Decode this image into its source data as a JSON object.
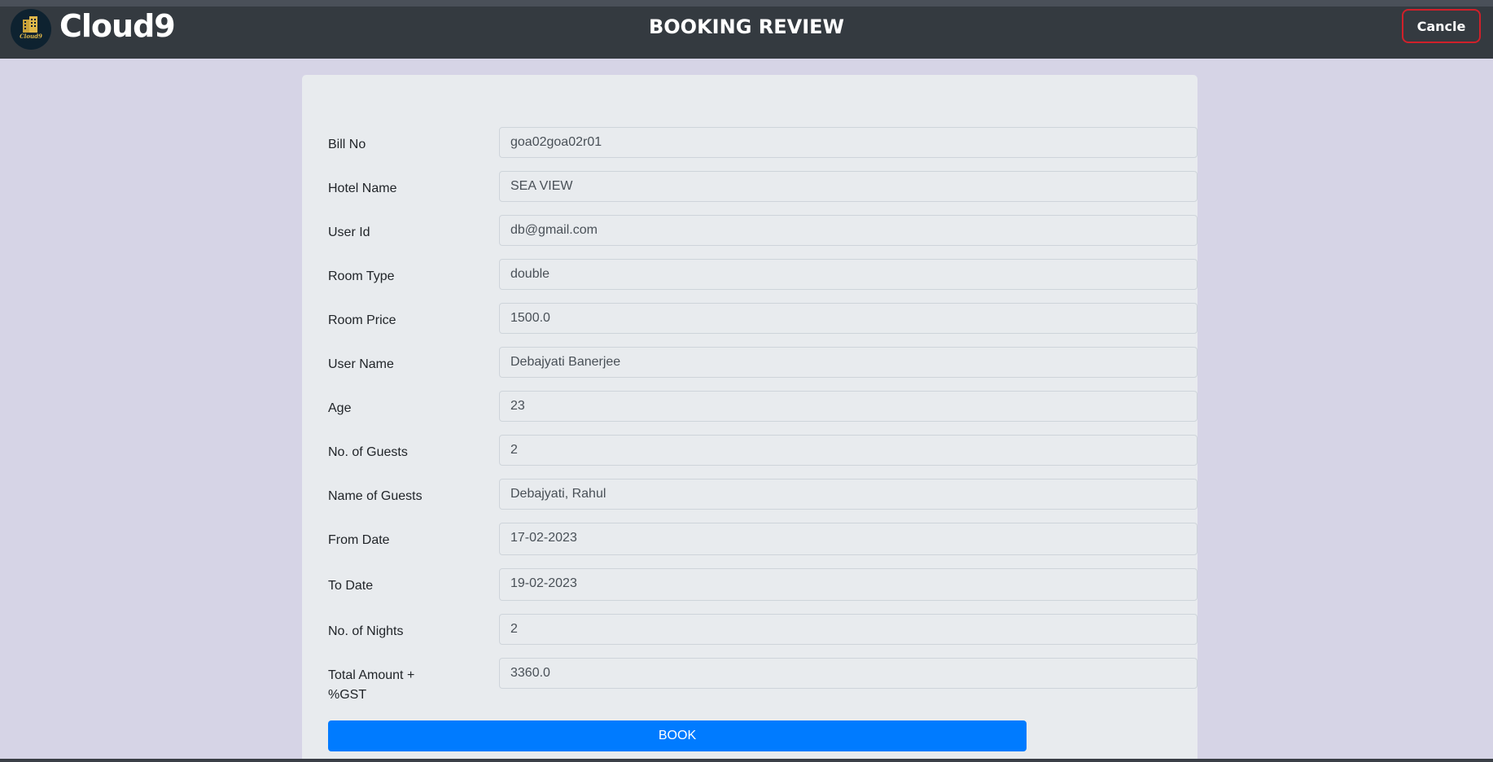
{
  "header": {
    "brand": "Cloud9",
    "logo_text": "Cloud9",
    "title": "BOOKING REVIEW",
    "cancel_label": "Cancle"
  },
  "form": {
    "fields": [
      {
        "label": "Bill No",
        "value": "goa02goa02r01"
      },
      {
        "label": "Hotel Name",
        "value": "SEA VIEW"
      },
      {
        "label": "User Id",
        "value": "db@gmail.com"
      },
      {
        "label": "Room Type",
        "value": "double"
      },
      {
        "label": "Room Price",
        "value": "1500.0"
      },
      {
        "label": "User Name",
        "value": "Debajyati Banerjee"
      },
      {
        "label": "Age",
        "value": "23"
      },
      {
        "label": "No. of Guests",
        "value": "2"
      },
      {
        "label": "Name of Guests",
        "value": "Debajyati, Rahul"
      },
      {
        "label": "From Date",
        "value": "17-02-2023"
      },
      {
        "label": "To Date",
        "value": "19-02-2023"
      },
      {
        "label": "No. of Nights",
        "value": "2"
      },
      {
        "label": "Total Amount + %GST",
        "value": "3360.0"
      }
    ],
    "book_label": "BOOK"
  },
  "colors": {
    "navbar": "#343a40",
    "background": "#d6d4e6",
    "card": "#e8ebee",
    "book_button": "#007bff",
    "cancel_border": "#d0202a"
  }
}
